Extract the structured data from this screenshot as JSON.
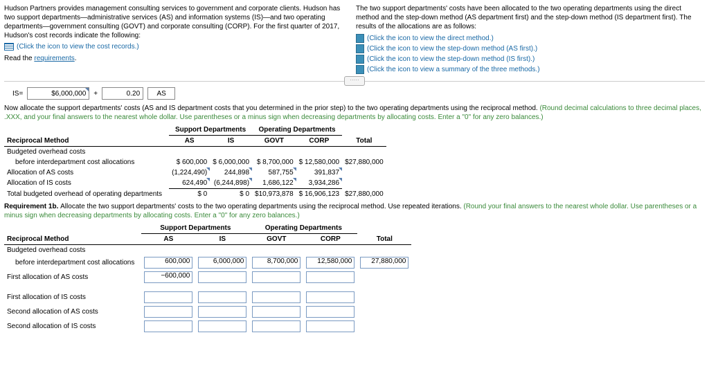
{
  "top_left": {
    "intro": "Hudson Partners provides management consulting services to government and corporate clients. Hudson has two support departments—administrative services (AS) and information systems (IS)—and two operating departments—government consulting (GOVT) and corporate consulting (CORP). For the first quarter of 2017, Hudson's cost records indicate the following:",
    "icon_link": "(Click the icon to view the cost records.)",
    "read_label": "Read the ",
    "requirements": "requirements"
  },
  "top_right": {
    "intro": "The two support departments' costs have been allocated to the two operating departments using the direct method and the step-down method (AS department first) and the step-down method (IS department first). The results of the allocations are as follows:",
    "l1": "(Click the icon to view the direct method.)",
    "l2": "(Click the icon to view the step-down method (AS first).)",
    "l3": "(Click the icon to view the step-down method (IS first).)",
    "l4": "(Click the icon to view a summary of the three methods.)"
  },
  "formula": {
    "is_label": "IS=",
    "v1": "$6,000,000",
    "plus": "+",
    "v2": "0.20",
    "as": "AS"
  },
  "instr1": {
    "black": "Now allocate the support departments' costs (AS and IS department costs that you determined in the prior step) to the two operating departments using the reciprocal method. ",
    "green": "(Round decimal calculations to three decimal places, .XXX, and your final answers to the nearest whole dollar. Use parentheses or a minus sign when decreasing departments by allocating costs. Enter a \"0\" for any zero balances.)"
  },
  "t1": {
    "support_hdr": "Support Departments",
    "operating_hdr": "Operating Departments",
    "rm": "Reciprocal Method",
    "as": "AS",
    "is": "IS",
    "govt": "GOVT",
    "corp": "CORP",
    "total": "Total",
    "r1": "Budgeted overhead costs",
    "r2": "before interdepartment cost allocations",
    "r2v": {
      "as": "$      600,000",
      "is": "$  6,000,000",
      "govt": "$  8,700,000",
      "corp": "$  12,580,000",
      "total": "$27,880,000"
    },
    "r3": "Allocation of AS costs",
    "r3v": {
      "as": "(1,224,490)",
      "is": "244,898",
      "govt": "587,755",
      "corp": "391,837"
    },
    "r4": "Allocation of IS costs",
    "r4v": {
      "as": "624,490",
      "is": "(6,244,898)",
      "govt": "1,686,122",
      "corp": "3,934,286"
    },
    "r5": "Total budgeted overhead of operating departments",
    "r5v": {
      "as": "$              0",
      "is": "$              0",
      "govt": "$10,973,878",
      "corp": "$  16,906,123",
      "total": "$27,880,000"
    }
  },
  "instr2": {
    "black": "Requirement 1b. ",
    "black2": "Allocate the two support departments' costs to the two operating departments using the reciprocal method. Use repeated iterations. ",
    "green": "(Round your final answers to the nearest whole dollar. Use parentheses or a minus sign when decreasing departments by allocating costs. Enter a \"0\" for any zero balances.)"
  },
  "t2": {
    "r2v": {
      "as": "600,000",
      "is": "6,000,000",
      "govt": "8,700,000",
      "corp": "12,580,000",
      "total": "27,880,000"
    },
    "r3": "First allocation of AS costs",
    "r3v": {
      "as": "−600,000"
    },
    "r4": "First allocation of IS costs",
    "r5": "Second allocation of AS costs",
    "r6": "Second allocation of IS costs"
  }
}
